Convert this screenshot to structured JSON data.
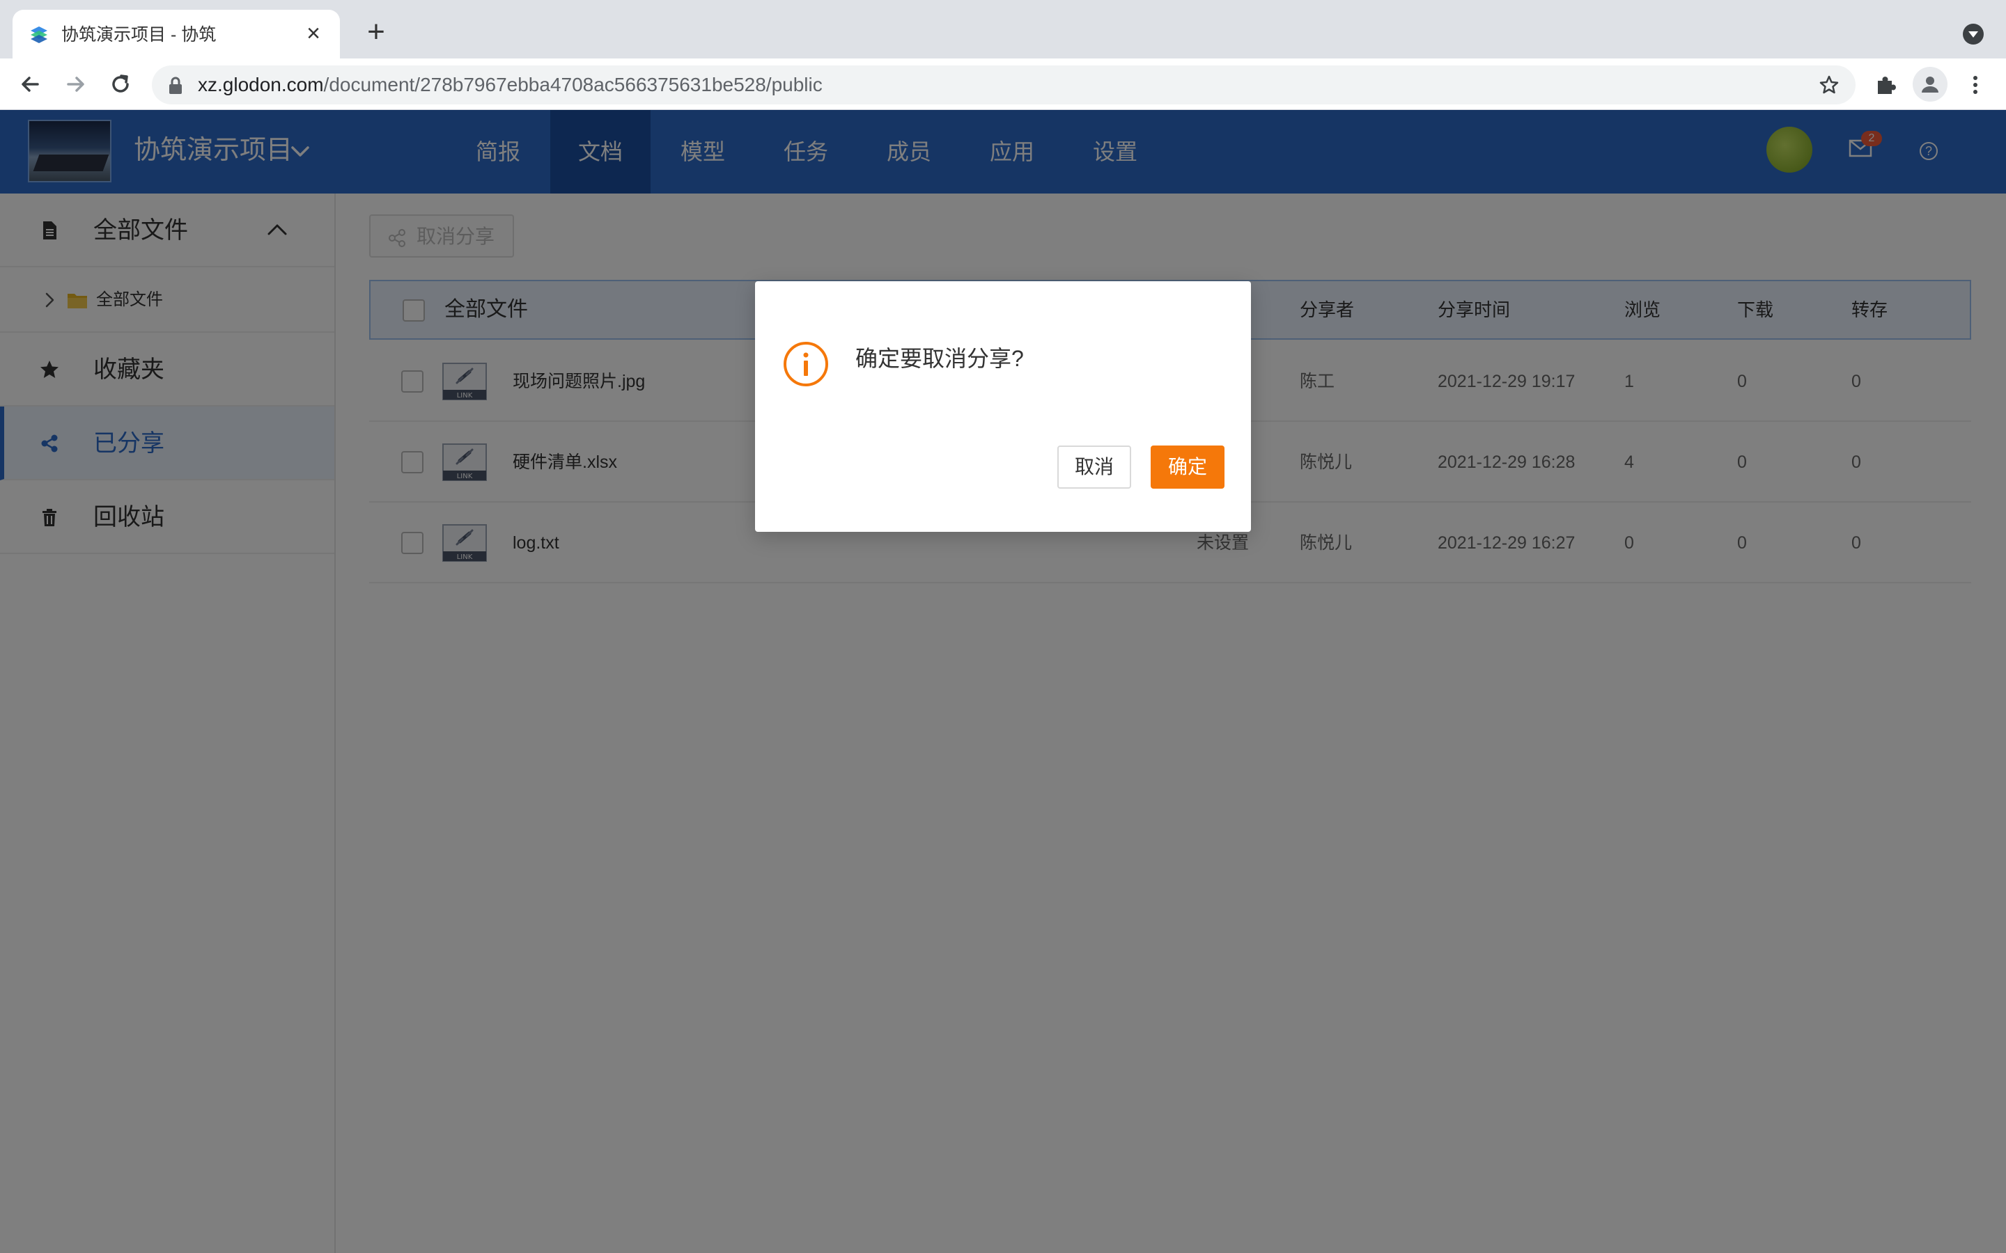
{
  "browser": {
    "tab_title": "协筑演示项目 - 协筑",
    "url_host": "xz.glodon.com",
    "url_path": "/document/278b7967ebba4708ac566375631be528/public"
  },
  "header": {
    "project_name": "协筑演示项目",
    "nav": [
      "简报",
      "文档",
      "模型",
      "任务",
      "成员",
      "应用",
      "设置"
    ],
    "active_nav": "文档",
    "mail_badge": "2",
    "help_glyph": "?"
  },
  "sidebar": {
    "all_files": "全部文件",
    "sub_all_files": "全部文件",
    "favorites": "收藏夹",
    "shared": "已分享",
    "recycle": "回收站"
  },
  "toolbar": {
    "cancel_share": "取消分享"
  },
  "table": {
    "columns": {
      "name": "全部文件",
      "sharer": "分享者",
      "share_time": "分享时间",
      "views": "浏览",
      "downloads": "下载",
      "saves": "转存"
    },
    "rows": [
      {
        "name": "现场问题照片.jpg",
        "expire": "",
        "sharer": "陈工",
        "time": "2021-12-29 19:17",
        "views": "1",
        "downloads": "0",
        "saves": "0"
      },
      {
        "name": "硬件清单.xlsx",
        "expire": "",
        "sharer": "陈悦儿",
        "time": "2021-12-29 16:28",
        "views": "4",
        "downloads": "0",
        "saves": "0"
      },
      {
        "name": "log.txt",
        "expire": "未设置",
        "sharer": "陈悦儿",
        "time": "2021-12-29 16:27",
        "views": "0",
        "downloads": "0",
        "saves": "0"
      }
    ]
  },
  "modal": {
    "message": "确定要取消分享?",
    "cancel": "取消",
    "confirm": "确定"
  },
  "colors": {
    "header_bg": "#2d6bc9",
    "active_nav_bg": "#1a4fa0",
    "confirm_btn": "#f5780a",
    "warning_icon": "#f5780a"
  }
}
